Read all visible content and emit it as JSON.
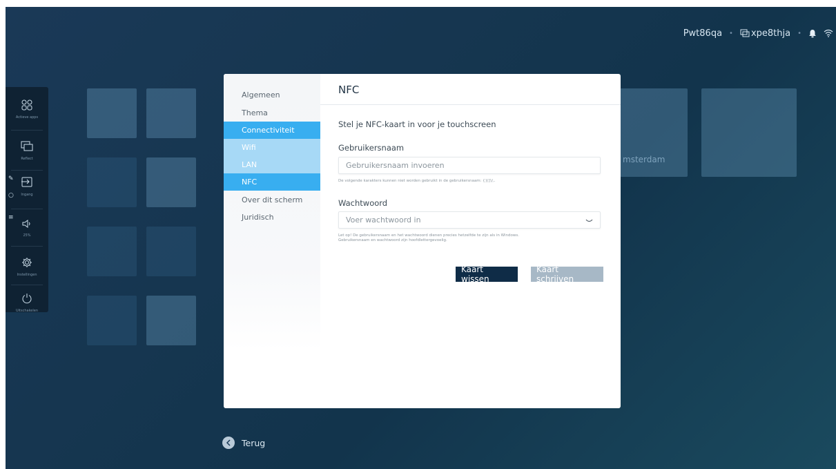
{
  "topbar": {
    "device_name": "Pwt86qa",
    "share_name": "xpe8thja"
  },
  "dock": {
    "items": [
      {
        "label": "Actieve apps"
      },
      {
        "label": "Reflect"
      },
      {
        "label": "Ingang"
      },
      {
        "label": "25%"
      },
      {
        "label": "Instellingen"
      },
      {
        "label": "Uitschakelen"
      }
    ]
  },
  "background": {
    "tile_text": "msterdam"
  },
  "settings": {
    "nav": [
      {
        "label": "Algemeen"
      },
      {
        "label": "Thema"
      },
      {
        "label": "Connectiviteit"
      },
      {
        "label": "Wifi"
      },
      {
        "label": "LAN"
      },
      {
        "label": "NFC"
      },
      {
        "label": "Over dit scherm"
      },
      {
        "label": "Juridisch"
      }
    ],
    "title": "NFC",
    "subtitle": "Stel je NFC-kaart in voor je touchscreen",
    "username": {
      "label": "Gebruikersnaam",
      "placeholder": "Gebruikersnaam invoeren",
      "hint": "De volgende karakters kunnen niet worden gebruikt in de gebruikersnaam: {}[]\\/,."
    },
    "password": {
      "label": "Wachtwoord",
      "placeholder": "Voer wachtwoord in",
      "hint_line1": "Let op! De gebruikersnaam en het wachtwoord dienen precies hetzelfde te zijn als in Windows.",
      "hint_line2": "Gebruikersnaam en wachtwoord zijn hoofdlettergevoelig."
    },
    "buttons": {
      "clear": "Kaart wissen",
      "write": "Kaart schrijven"
    }
  },
  "footer": {
    "back_label": "Terug"
  },
  "colors": {
    "accent": "#38aef0",
    "accent_light": "#a7d9f6",
    "dark_button": "#0f2c47",
    "disabled_button": "#a7b8c6"
  }
}
